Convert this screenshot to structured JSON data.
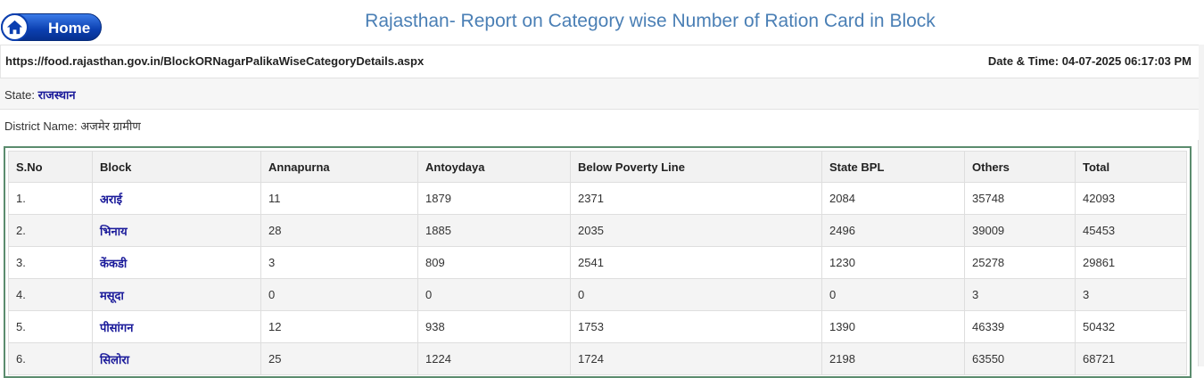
{
  "header": {
    "home_label": "Home",
    "title": "Rajasthan- Report on Category wise Number of Ration Card in Block"
  },
  "info": {
    "url": "https://food.rajasthan.gov.in/BlockORNagarPalikaWiseCategoryDetails.aspx",
    "datetime_label": "Date & Time:",
    "datetime_value": "04-07-2025 06:17:03 PM",
    "state_label": "State:",
    "state_value": "राजस्थान",
    "district_label": "District Name:",
    "district_value": "अजमेर  ग्रामीण"
  },
  "table": {
    "columns": [
      "S.No",
      "Block",
      "Annapurna",
      "Antoydaya",
      "Below Poverty Line",
      "State BPL",
      "Others",
      "Total"
    ],
    "rows": [
      [
        "1.",
        "अराई",
        "11",
        "1879",
        "2371",
        "2084",
        "35748",
        "42093"
      ],
      [
        "2.",
        "भिनाय",
        "28",
        "1885",
        "2035",
        "2496",
        "39009",
        "45453"
      ],
      [
        "3.",
        "केंकडी",
        "3",
        "809",
        "2541",
        "1230",
        "25278",
        "29861"
      ],
      [
        "4.",
        "मसूदा",
        "0",
        "0",
        "0",
        "0",
        "3",
        "3"
      ],
      [
        "5.",
        "पीसांगन",
        "12",
        "938",
        "1753",
        "1390",
        "46339",
        "50432"
      ],
      [
        "6.",
        "सिलोरा",
        "25",
        "1224",
        "1724",
        "2198",
        "63550",
        "68721"
      ]
    ]
  }
}
